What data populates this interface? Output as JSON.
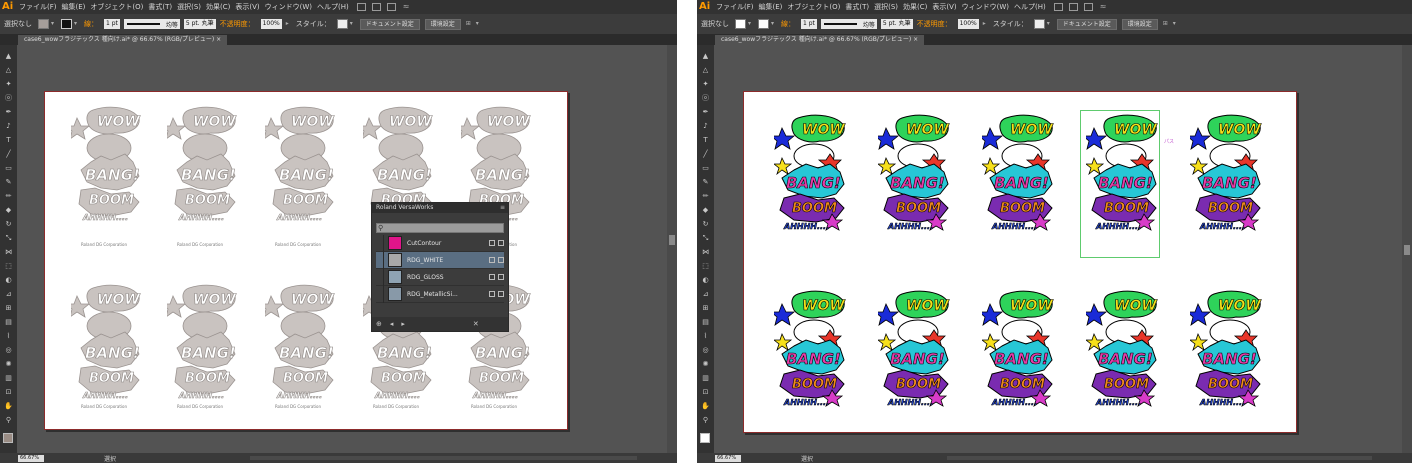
{
  "left": {
    "menu": [
      "ファイル(F)",
      "編集(E)",
      "オブジェクト(O)",
      "書式(T)",
      "選択(S)",
      "効果(C)",
      "表示(V)",
      "ウィンドウ(W)",
      "ヘルプ(H)"
    ],
    "control": {
      "selection_label": "選択なし",
      "stroke_label": "線：",
      "stroke_weight": "1 pt",
      "stroke_profile": "均等",
      "brush": "5 pt. 丸筆",
      "opacity_label": "不透明度：",
      "opacity_value": "100%",
      "style_label": "スタイル：",
      "doc_settings": "ドキュメント設定",
      "preferences": "環境設定"
    },
    "tab": "case6_wowフラジテックス 種向け.ai* @ 66.67% (RGB/プレビュー)",
    "credit": "Roland DG Corporation",
    "status": {
      "zoom": "66.67%",
      "mode": "選択"
    },
    "panel": {
      "title": "Roland VersaWorks",
      "items": [
        {
          "label": "CutContour",
          "color": "#e0158a"
        },
        {
          "label": "RDG_WHITE",
          "color": "#a8a8a8"
        },
        {
          "label": "RDG_GLOSS",
          "color": "#8fa3b3"
        },
        {
          "label": "RDG_MetallicSi...",
          "color": "#8899a8"
        }
      ]
    }
  },
  "right": {
    "menu": [
      "ファイル(F)",
      "編集(E)",
      "オブジェクト(O)",
      "書式(T)",
      "選択(S)",
      "効果(C)",
      "表示(V)",
      "ウィンドウ(W)",
      "ヘルプ(H)"
    ],
    "control": {
      "selection_label": "選択なし",
      "stroke_label": "線：",
      "stroke_weight": "1 pt",
      "stroke_profile": "均等",
      "brush": "5 pt. 丸筆",
      "opacity_label": "不透明度：",
      "opacity_value": "100%",
      "style_label": "スタイル：",
      "doc_settings": "ドキュメント設定",
      "preferences": "環境設定"
    },
    "tab": "case6_wowフラジテックス 種向け.ai* @ 66.67% (RGB/プレビュー)",
    "path_label": "パス",
    "status": {
      "zoom": "66.67%",
      "mode": "選択"
    }
  },
  "colors": {
    "accent_orange": "#ff9a00",
    "artboard_border": "#8c2b2b",
    "selection_green": "#5ecb6e"
  }
}
